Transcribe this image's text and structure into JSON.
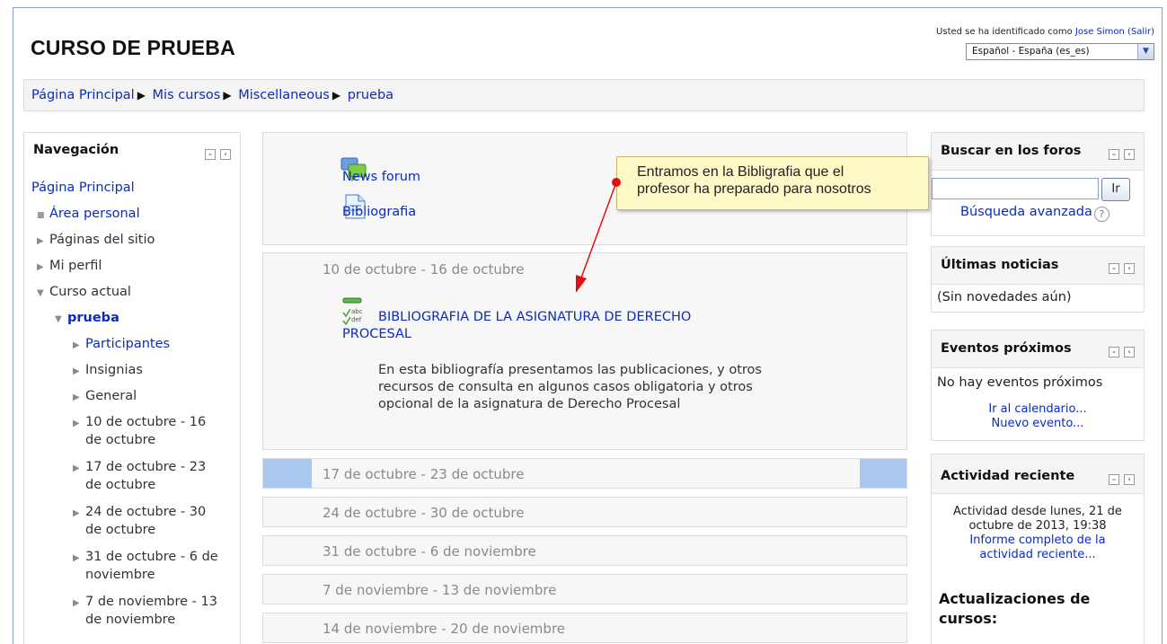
{
  "site": {
    "title": "CURSO DE PRUEBA"
  },
  "login": {
    "prefix": "Usted se ha identificado como",
    "user": "Jose Simon",
    "logout": "(Salir)"
  },
  "language": {
    "selected": "Español - España (es_es)"
  },
  "breadcrumb": {
    "items": [
      "Página Principal",
      "Mis cursos",
      "Miscellaneous",
      "prueba"
    ]
  },
  "navigation": {
    "title": "Navegación",
    "home": "Página Principal",
    "items": [
      "Área personal",
      "Páginas del sitio",
      "Mi perfil",
      "Curso actual",
      "prueba",
      "Participantes",
      "Insignias",
      "General",
      "10 de octubre - 16",
      "de octubre",
      "17 de octubre - 23",
      "de octubre",
      "24 de octubre - 30",
      "de octubre",
      "31 de octubre - 6 de",
      "noviembre",
      "7 de noviembre - 13",
      "de noviembre"
    ]
  },
  "course": {
    "activities": [
      {
        "label": "News forum",
        "icon": "forum-icon"
      },
      {
        "label": "Bibliografia",
        "icon": "page-icon"
      }
    ],
    "weeks": [
      "10 de octubre - 16 de octubre",
      "17 de octubre - 23 de octubre",
      "24 de octubre - 30 de octubre",
      "31 de octubre - 6 de noviembre",
      "7 de noviembre - 13 de noviembre",
      "14 de noviembre - 20 de noviembre"
    ],
    "glossary": {
      "line1": "BIBLIOGRAFIA DE LA ASIGNATURA DE DERECHO",
      "line2": "PROCESAL",
      "desc1": "En esta bibliografía presentamos las publicaciones, y otros",
      "desc2": "recursos de consulta en algunos casos obligatoria y otros",
      "desc3": "opcional de la asignatura de Derecho Procesal"
    }
  },
  "callout": {
    "line1": "Entramos en la Bibligrafia que el",
    "line2": "profesor ha preparado para nosotros"
  },
  "blocks": {
    "search": {
      "title": "Buscar en los foros",
      "button": "Ir",
      "advanced": "Búsqueda avanzada"
    },
    "news": {
      "title": "Últimas noticias",
      "body": "(Sin novedades aún)"
    },
    "events": {
      "title": "Eventos próximos",
      "body": "No hay eventos próximos",
      "calendar": "Ir al calendario...",
      "new_event": "Nuevo evento..."
    },
    "recent": {
      "title": "Actividad reciente",
      "since1": "Actividad desde lunes, 21 de",
      "since2": "octubre de 2013, 19:38",
      "report1": "Informe completo de la",
      "report2": "actividad reciente...",
      "updates1": "Actualizaciones de",
      "updates2": "cursos:"
    }
  },
  "colors": {
    "link": "#0a2bbf",
    "highlight": "#a9c8f0",
    "callout": "#fff9c8",
    "arrow": "#e01010"
  }
}
